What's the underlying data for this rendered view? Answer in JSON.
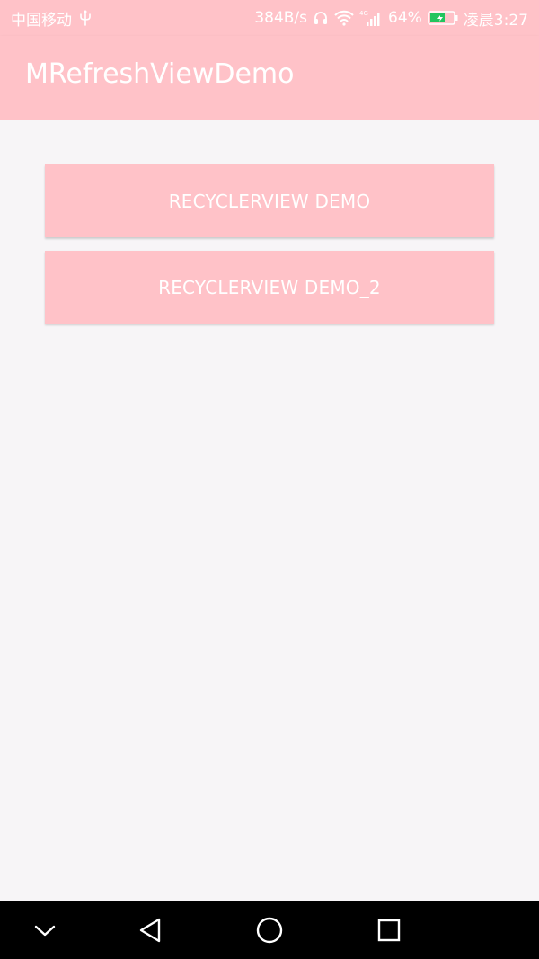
{
  "status_bar": {
    "carrier": "中国移动",
    "usb_icon": "usb-icon",
    "net_speed": "384B/s",
    "battery_percent": "64%",
    "time": "凌晨3:27",
    "icons": [
      "headset-icon",
      "wifi-icon",
      "4g-signal-icon",
      "battery-icon"
    ],
    "battery_level": 0.64,
    "battery_color": "#22c55e"
  },
  "app_bar": {
    "title": "MRefreshViewDemo",
    "color": "#ffc2c8"
  },
  "main": {
    "buttons": [
      {
        "label": "RECYCLERVIEW DEMO"
      },
      {
        "label": "RECYCLERVIEW DEMO_2"
      }
    ]
  },
  "nav_bar": {
    "items": [
      "chevron-down-icon",
      "back-triangle-icon",
      "home-circle-icon",
      "recent-square-icon"
    ]
  }
}
